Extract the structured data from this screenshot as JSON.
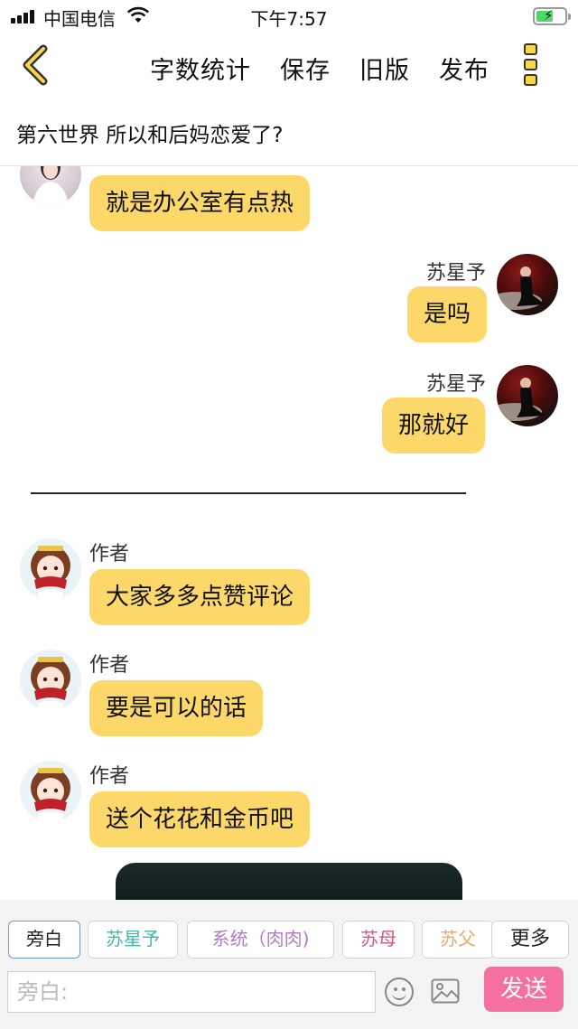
{
  "status_bar": {
    "carrier": "中国电信",
    "time": "下午7:57"
  },
  "nav": {
    "actions": [
      "字数统计",
      "保存",
      "旧版",
      "发布"
    ]
  },
  "chapter_title": "第六世界  所以和后妈恋爱了?",
  "messages": [
    {
      "side": "left",
      "sender": "",
      "text": "就是办公室有点热",
      "avatar": "woman-avatar"
    },
    {
      "side": "right",
      "sender": "苏星予",
      "text": "是吗",
      "avatar": "dark-dress-avatar"
    },
    {
      "side": "right",
      "sender": "苏星予",
      "text": "那就好",
      "avatar": "dark-dress-avatar"
    },
    {
      "side": "left",
      "sender": "作者",
      "text": "大家多多点赞评论",
      "avatar": "cartoon-girl-avatar"
    },
    {
      "side": "left",
      "sender": "作者",
      "text": "要是可以的话",
      "avatar": "cartoon-girl-avatar"
    },
    {
      "side": "left",
      "sender": "作者",
      "text": "送个花花和金币吧",
      "avatar": "cartoon-girl-avatar"
    }
  ],
  "roles": [
    {
      "label": "旁白",
      "color": "#222222",
      "active": true
    },
    {
      "label": "苏星予",
      "color": "#3fb8a8"
    },
    {
      "label": "系统（肉肉)",
      "color": "#b07cc6"
    },
    {
      "label": "苏母",
      "color": "#d9508a"
    },
    {
      "label": "苏父",
      "color": "#e8a86a"
    },
    {
      "label": "更多",
      "color": "#222222"
    }
  ],
  "composer": {
    "placeholder": "旁白:",
    "send_label": "发送"
  },
  "colors": {
    "bubble": "#fcd86a",
    "send": "#f56fa0",
    "accent_icon": "#f7d64a"
  }
}
